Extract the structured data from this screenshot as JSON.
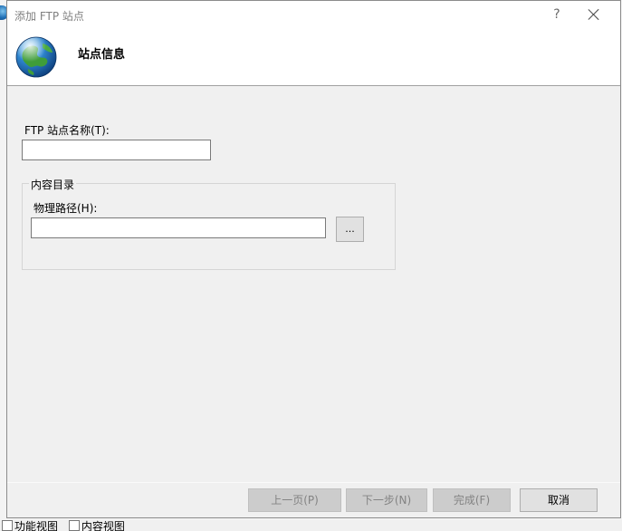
{
  "background": {
    "status_tabs": [
      {
        "label": "功能视图",
        "icon": "feature-view-icon"
      },
      {
        "label": "内容视图",
        "icon": "content-view-icon"
      }
    ]
  },
  "dialog": {
    "title": "添加 FTP 站点",
    "help_label": "?",
    "header": {
      "title": "站点信息",
      "icon": "globe-icon"
    },
    "site_name": {
      "label": "FTP 站点名称(T):",
      "value": "",
      "placeholder": ""
    },
    "content_directory": {
      "legend": "内容目录",
      "physical_path_label": "物理路径(H):",
      "physical_path_value": "",
      "browse_label": "..."
    },
    "buttons": {
      "previous": "上一页(P)",
      "next": "下一步(N)",
      "finish": "完成(F)",
      "cancel": "取消"
    },
    "colors": {
      "dialog_bg": "#f0f0f0",
      "header_bg": "#ffffff",
      "disabled_button_bg": "#cccccc",
      "disabled_text": "#838383"
    }
  }
}
